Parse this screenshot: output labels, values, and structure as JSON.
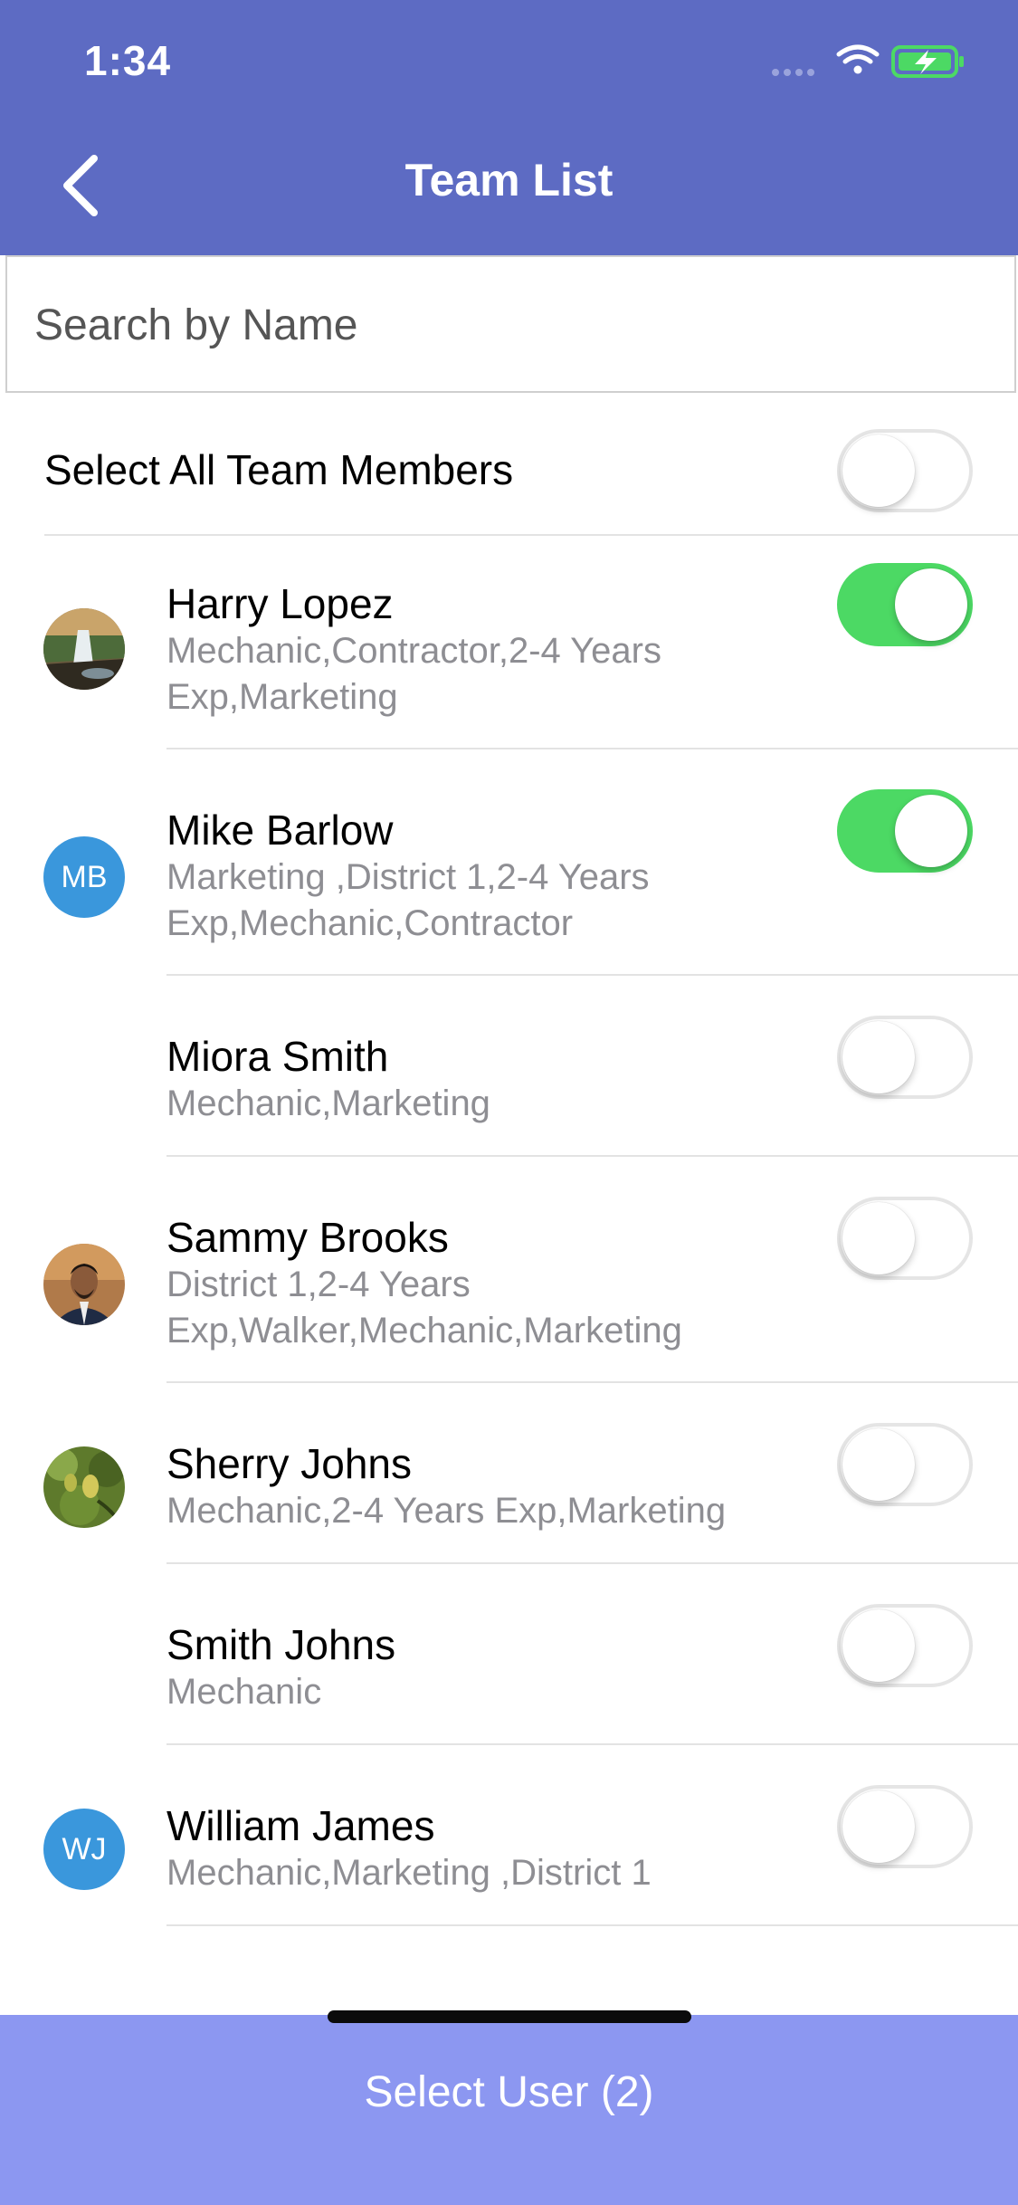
{
  "status_bar": {
    "time": "1:34",
    "icons": [
      "signal-icon",
      "wifi-icon",
      "battery-charging-icon"
    ]
  },
  "header": {
    "title": "Team List",
    "back_icon": "chevron-left-icon",
    "background_color": "#5d6bc3"
  },
  "search": {
    "placeholder": "Search by Name",
    "value": ""
  },
  "select_all": {
    "label": "Select All Team Members",
    "checked": false
  },
  "members": [
    {
      "name": "Harry Lopez",
      "subtitle": "Mechanic,Contractor,2-4 Years Exp,Marketing",
      "avatar_type": "photo",
      "avatar_icon": "waterfall-photo",
      "selected": true
    },
    {
      "name": "Mike Barlow",
      "subtitle": "Marketing ,District 1,2-4 Years Exp,Mechanic,Contractor",
      "avatar_type": "initials",
      "initials": "MB",
      "selected": true
    },
    {
      "name": "Miora Smith",
      "subtitle": "Mechanic,Marketing",
      "avatar_type": "none",
      "selected": false
    },
    {
      "name": "Sammy Brooks",
      "subtitle": "District 1,2-4 Years Exp,Walker,Mechanic,Marketing",
      "avatar_type": "photo",
      "avatar_icon": "portrait-photo",
      "selected": false
    },
    {
      "name": "Sherry Johns",
      "subtitle": "Mechanic,2-4 Years Exp,Marketing",
      "avatar_type": "photo",
      "avatar_icon": "plant-photo",
      "selected": false
    },
    {
      "name": "Smith Johns",
      "subtitle": "Mechanic",
      "avatar_type": "none",
      "selected": false
    },
    {
      "name": "William James",
      "subtitle": "Mechanic,Marketing ,District 1",
      "avatar_type": "initials",
      "initials": "WJ",
      "selected": false
    }
  ],
  "footer": {
    "button_label": "Select User (2)",
    "button_color": "#8c97f1"
  },
  "colors": {
    "toggle_on": "#4cd964",
    "avatar_initials": "#3a97dc",
    "subtitle_gray": "#8e8e93"
  }
}
